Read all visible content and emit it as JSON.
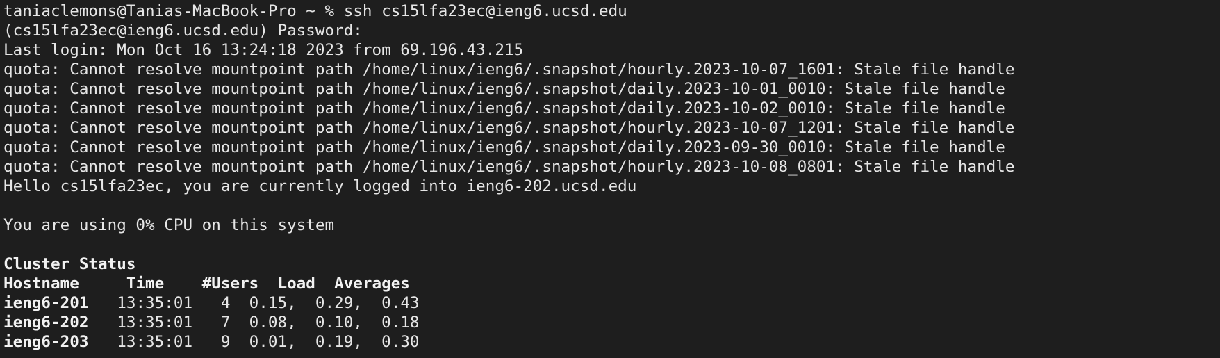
{
  "terminal": {
    "lines": [
      "taniaclemons@Tanias-MacBook-Pro ~ % ssh cs15lfa23ec@ieng6.ucsd.edu",
      "(cs15lfa23ec@ieng6.ucsd.edu) Password:",
      "Last login: Mon Oct 16 13:24:18 2023 from 69.196.43.215",
      "quota: Cannot resolve mountpoint path /home/linux/ieng6/.snapshot/hourly.2023-10-07_1601: Stale file handle",
      "quota: Cannot resolve mountpoint path /home/linux/ieng6/.snapshot/daily.2023-10-01_0010: Stale file handle",
      "quota: Cannot resolve mountpoint path /home/linux/ieng6/.snapshot/daily.2023-10-02_0010: Stale file handle",
      "quota: Cannot resolve mountpoint path /home/linux/ieng6/.snapshot/hourly.2023-10-07_1201: Stale file handle",
      "quota: Cannot resolve mountpoint path /home/linux/ieng6/.snapshot/daily.2023-09-30_0010: Stale file handle",
      "quota: Cannot resolve mountpoint path /home/linux/ieng6/.snapshot/hourly.2023-10-08_0801: Stale file handle",
      "Hello cs15lfa23ec, you are currently logged into ieng6-202.ucsd.edu",
      "",
      "You are using 0% CPU on this system",
      ""
    ],
    "cluster": {
      "title": "Cluster Status",
      "header": "Hostname     Time    #Users  Load  Averages",
      "rows": [
        {
          "host": "ieng6-201",
          "rest": "   13:35:01   4  0.15,  0.29,  0.43"
        },
        {
          "host": "ieng6-202",
          "rest": "   13:35:01   7  0.08,  0.10,  0.18"
        },
        {
          "host": "ieng6-203",
          "rest": "   13:35:01   9  0.01,  0.19,  0.30"
        }
      ]
    }
  }
}
